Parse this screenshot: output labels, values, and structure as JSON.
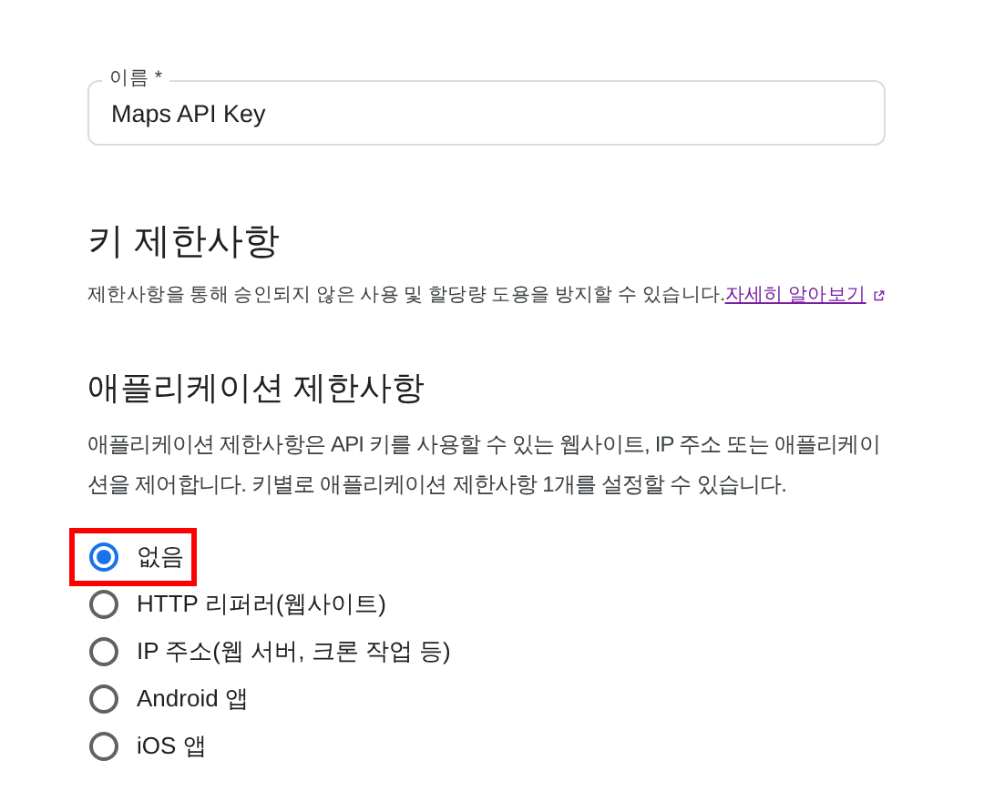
{
  "name_field": {
    "label": "이름 *",
    "value": "Maps API Key"
  },
  "key_restrictions": {
    "title": "키 제한사항",
    "description": "제한사항을 통해 승인되지 않은 사용 및 할당량 도용을 방지할 수 있습니다.",
    "link": "자세히 알아보기"
  },
  "application_restrictions": {
    "title": "애플리케이션 제한사항",
    "description": "애플리케이션 제한사항은 API 키를 사용할 수 있는 웹사이트, IP 주소 또는 애플리케이션을 제어합니다. 키별로 애플리케이션 제한사항 1개를 설정할 수 있습니다.",
    "options": [
      {
        "label": "없음",
        "selected": true,
        "highlighted": true
      },
      {
        "label": "HTTP 리퍼러(웹사이트)",
        "selected": false,
        "highlighted": false
      },
      {
        "label": "IP 주소(웹 서버, 크론 작업 등)",
        "selected": false,
        "highlighted": false
      },
      {
        "label": "Android 앱",
        "selected": false,
        "highlighted": false
      },
      {
        "label": "iOS 앱",
        "selected": false,
        "highlighted": false
      }
    ]
  }
}
